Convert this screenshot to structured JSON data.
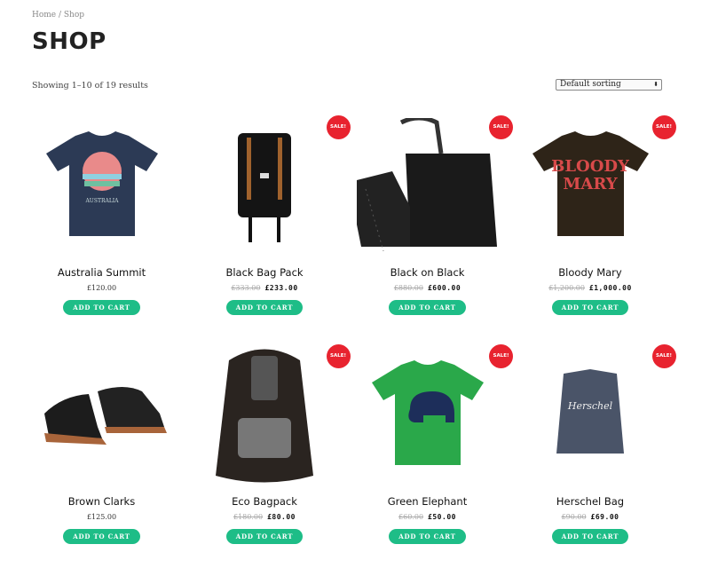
{
  "breadcrumb": "Home / Shop",
  "page_title": "SHOP",
  "result_count": "Showing 1–10 of 19 results",
  "sorting": {
    "selected": "Default sorting",
    "icon": "updown-arrows-icon"
  },
  "sale_label": "SALE!",
  "add_to_cart_label": "ADD TO CART",
  "colors": {
    "accent": "#1ebd87",
    "sale": "#e8232f"
  },
  "products": [
    {
      "name": "Australia Summit",
      "price": "£120.00",
      "sale": false
    },
    {
      "name": "Black Bag Pack",
      "old_price": "£333.00",
      "price": "£233.00",
      "sale": true
    },
    {
      "name": "Black on Black",
      "old_price": "£880.00",
      "price": "£600.00",
      "sale": true
    },
    {
      "name": "Bloody Mary",
      "old_price": "£1,200.00",
      "price": "£1,000.00",
      "sale": true
    },
    {
      "name": "Brown Clarks",
      "price": "£125.00",
      "sale": false
    },
    {
      "name": "Eco Bagpack",
      "old_price": "£180.00",
      "price": "£80.00",
      "sale": true
    },
    {
      "name": "Green Elephant",
      "old_price": "£60.00",
      "price": "£50.00",
      "sale": true
    },
    {
      "name": "Herschel Bag",
      "old_price": "£90.00",
      "price": "£69.00",
      "sale": true
    }
  ]
}
